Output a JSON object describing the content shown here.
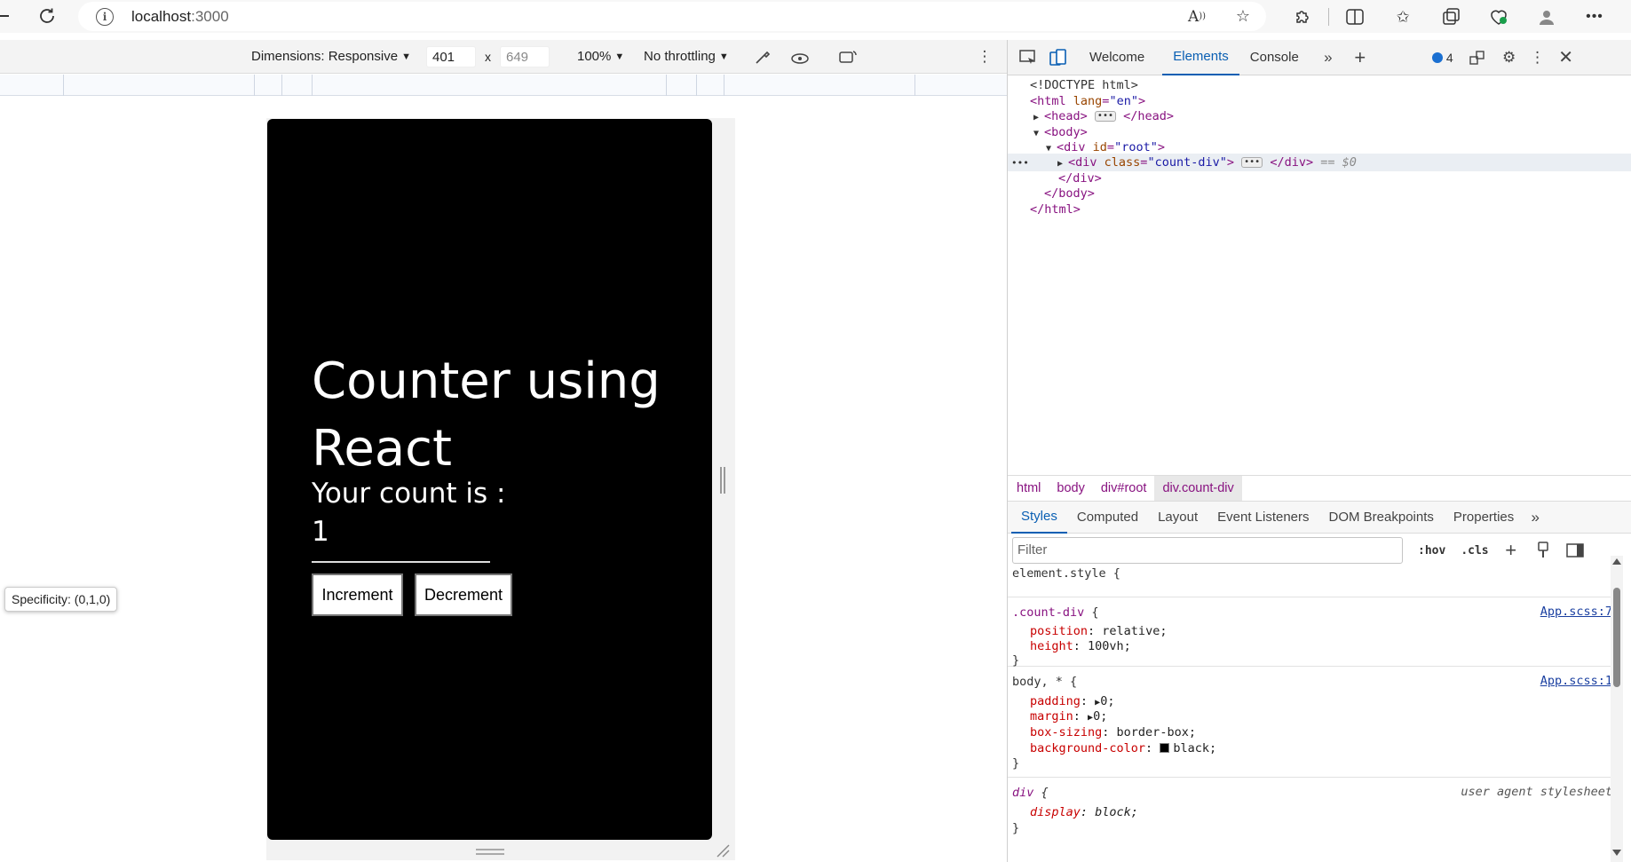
{
  "browser": {
    "url_host": "localhost",
    "url_port": ":3000"
  },
  "device_toolbar": {
    "dimensions_label": "Dimensions: Responsive",
    "width": "401",
    "height": "649",
    "times": "x",
    "zoom": "100%",
    "throttling": "No throttling"
  },
  "app": {
    "title": "Counter using React",
    "count_label": "Your count is :",
    "count_value": "1",
    "increment_label": "Increment",
    "decrement_label": "Decrement"
  },
  "devtools": {
    "tabs": [
      {
        "label": "Welcome",
        "active": false
      },
      {
        "label": "Elements",
        "active": true
      },
      {
        "label": "Console",
        "active": false
      }
    ],
    "issues_count": "4",
    "dom": {
      "doctype": "<!DOCTYPE html>",
      "html_open_tag": "<html",
      "lang_attr": "lang",
      "lang_val": "\"en\"",
      "gt": ">",
      "head_open": "<head>",
      "head_close": "</head>",
      "body_open": "<body>",
      "div_open": "<div",
      "id_attr": "id",
      "id_val": "\"root\"",
      "class_attr": "class",
      "class_val": "\"count-div\"",
      "div_close": "</div>",
      "body_close": "</body>",
      "html_close": "</html>",
      "selected_marker": "== $0"
    },
    "breadcrumbs": [
      "html",
      "body",
      "div#root",
      "div.count-div"
    ],
    "sub_tabs": [
      {
        "label": "Styles",
        "active": true
      },
      {
        "label": "Computed",
        "active": false
      },
      {
        "label": "Layout",
        "active": false
      },
      {
        "label": "Event Listeners",
        "active": false
      },
      {
        "label": "DOM Breakpoints",
        "active": false
      },
      {
        "label": "Properties",
        "active": false
      }
    ],
    "filter_placeholder": "Filter",
    "hov_label": ":hov",
    "cls_label": ".cls",
    "tooltip": "Specificity: (0,1,0)",
    "styles": {
      "element_style": "element.style {",
      "rule1_selector": ".count-div",
      "rule1_source": "App.scss:7",
      "rule1_props": [
        {
          "name": "position",
          "value": "relative;"
        },
        {
          "name": "height",
          "value": "100vh;"
        }
      ],
      "rule2_selector_a": "body, ",
      "rule2_selector_b": "*",
      "rule2_source": "App.scss:1",
      "rule2_props": [
        {
          "name": "padding",
          "value": "0;"
        },
        {
          "name": "margin",
          "value": "0;"
        },
        {
          "name": "box-sizing",
          "value": "border-box;"
        },
        {
          "name": "background-color",
          "value": "black;"
        }
      ],
      "rule3_selector": "div",
      "rule3_source": "user agent stylesheet",
      "rule3_props": [
        {
          "name": "display",
          "value": "block;"
        }
      ],
      "open_brace": " {",
      "close_brace": "}"
    }
  },
  "colors": {
    "accent_blue": "#0a5fb3",
    "tag_purple": "#881280"
  }
}
